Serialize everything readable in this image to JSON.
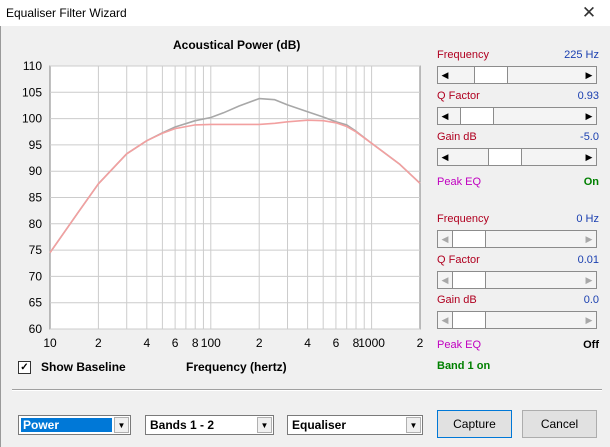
{
  "window": {
    "title": "Equaliser Filter Wizard",
    "close_glyph": "✕"
  },
  "chart": {
    "title": "Acoustical Power (dB)",
    "show_baseline_label": "Show Baseline",
    "show_baseline_checked": true,
    "xlabel": "Frequency (hertz)"
  },
  "chart_data": {
    "type": "line",
    "title": "Acoustical Power (dB)",
    "xlabel": "Frequency (hertz)",
    "ylabel": "",
    "x_scale": "log",
    "xlim": [
      10,
      2000
    ],
    "ylim": [
      60,
      110
    ],
    "y_ticks": [
      60,
      65,
      70,
      75,
      80,
      85,
      90,
      95,
      100,
      105,
      110
    ],
    "x_tick_labels": [
      {
        "x": 10,
        "label": "10"
      },
      {
        "x": 20,
        "label": "2"
      },
      {
        "x": 40,
        "label": "4"
      },
      {
        "x": 60,
        "label": "6"
      },
      {
        "x": 80,
        "label": "8"
      },
      {
        "x": 100,
        "label": "100"
      },
      {
        "x": 200,
        "label": "2"
      },
      {
        "x": 400,
        "label": "4"
      },
      {
        "x": 600,
        "label": "6"
      },
      {
        "x": 800,
        "label": "8"
      },
      {
        "x": 1000,
        "label": "1000"
      },
      {
        "x": 2000,
        "label": "2"
      }
    ],
    "grid": true,
    "series": [
      {
        "color": "#a8a8a8",
        "x": [
          10,
          15,
          20,
          30,
          40,
          50,
          60,
          80,
          100,
          120,
          150,
          200,
          250,
          300,
          400,
          500,
          600,
          700,
          800,
          1000,
          1500,
          2000
        ],
        "y": [
          74.5,
          82.2,
          87.6,
          93.3,
          95.8,
          97.3,
          98.4,
          99.6,
          100.2,
          101.1,
          102.4,
          103.8,
          103.6,
          102.6,
          101.3,
          100.3,
          99.4,
          98.8,
          97.6,
          95.3,
          91.3,
          87.7
        ]
      },
      {
        "color": "#f2a0a0",
        "x": [
          10,
          15,
          20,
          30,
          40,
          50,
          60,
          80,
          100,
          150,
          200,
          250,
          300,
          400,
          500,
          600,
          700,
          800,
          1000,
          1500,
          2000
        ],
        "y": [
          74.5,
          82.2,
          87.6,
          93.3,
          95.8,
          97.2,
          98.1,
          98.8,
          98.9,
          98.9,
          98.9,
          99.1,
          99.4,
          99.7,
          99.6,
          99.2,
          98.5,
          97.5,
          95.3,
          91.3,
          87.7
        ]
      }
    ]
  },
  "band1": {
    "frequency_label": "Frequency",
    "frequency_value": "225 Hz",
    "frequency_pos": 0.22,
    "q_label": "Q Factor",
    "q_value": "0.93",
    "q_pos": 0.08,
    "gain_label": "Gain  dB",
    "gain_value": "-5.0",
    "gain_pos": 0.37,
    "type_label": "Peak EQ",
    "state": "On"
  },
  "band2": {
    "frequency_label": "Frequency",
    "frequency_value": "0 Hz",
    "frequency_pos": 0.0,
    "q_label": "Q Factor",
    "q_value": "0.01",
    "q_pos": 0.0,
    "gain_label": "Gain  dB",
    "gain_value": "0.0",
    "gain_pos": 0.0,
    "type_label": "Peak EQ",
    "state": "Off"
  },
  "band_status": "Band 1 on",
  "controls": {
    "mode_select": "Power",
    "bands_select": "Bands 1 - 2",
    "type_select": "Equaliser",
    "capture_label": "Capture",
    "cancel_label": "Cancel"
  },
  "colors": {
    "band_label": "#b00020",
    "value": "#1a3fb0",
    "eq_label": "#c000c0",
    "on": "#008000"
  }
}
